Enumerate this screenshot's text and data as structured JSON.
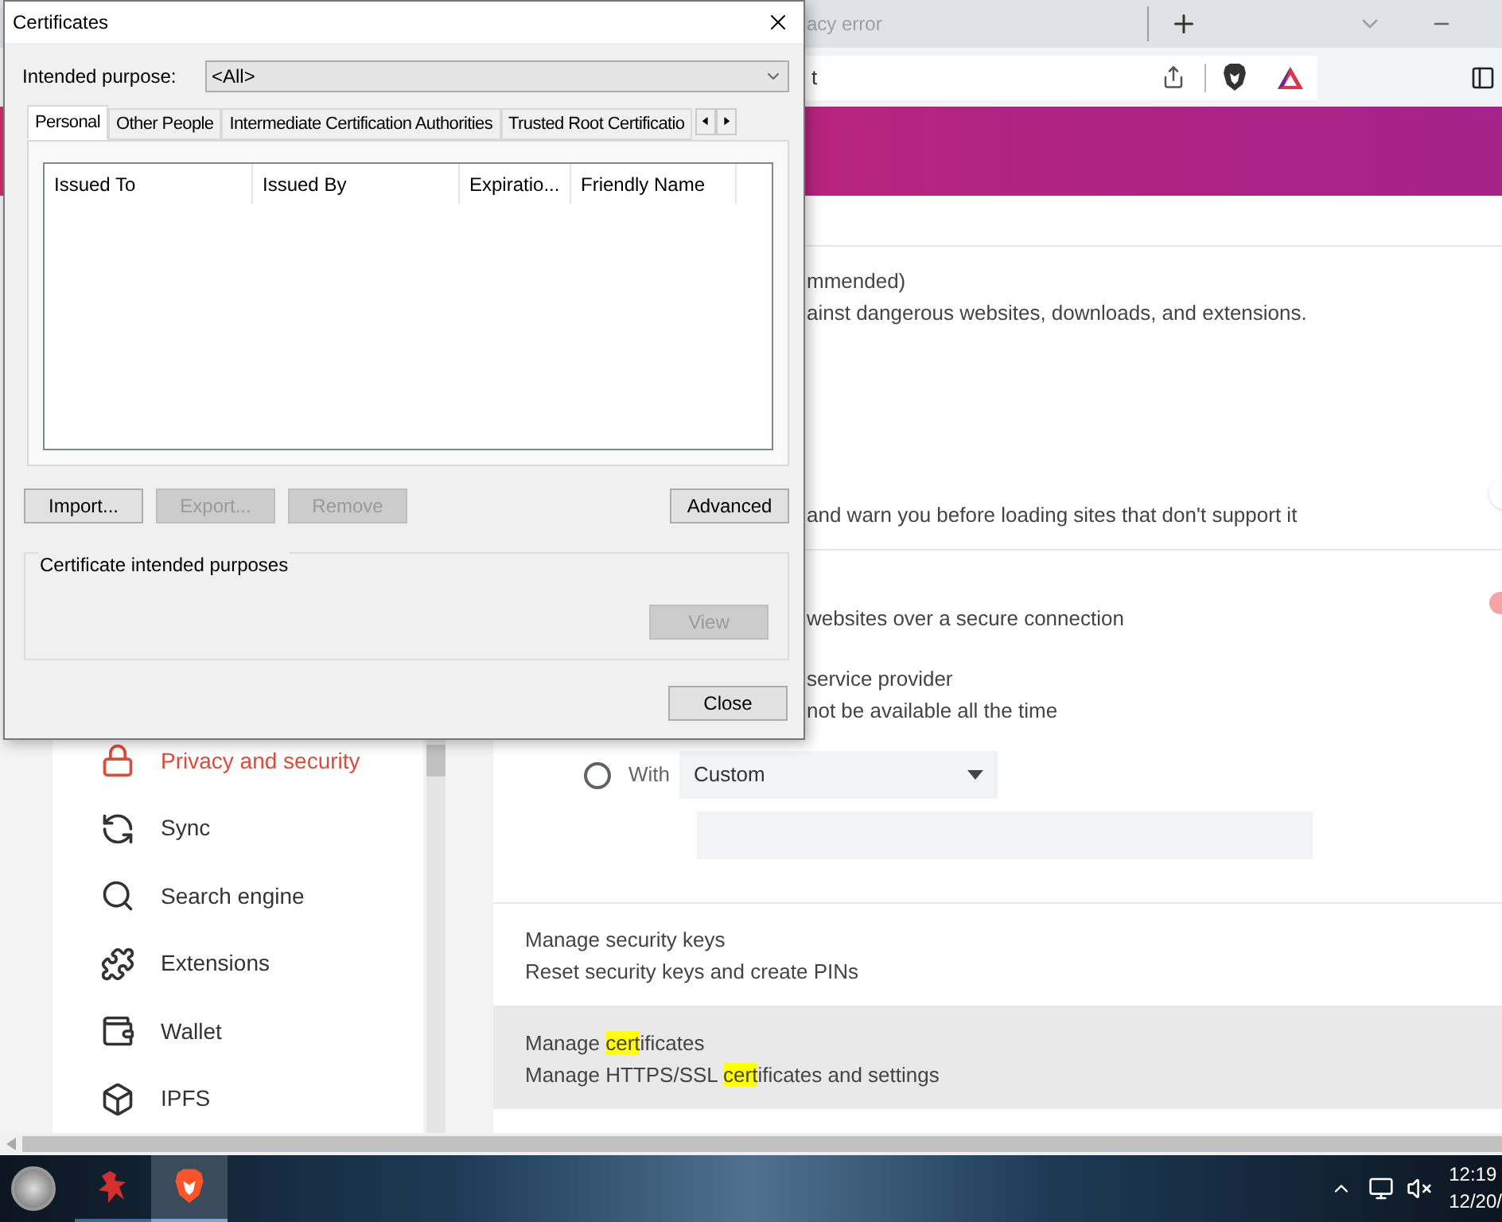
{
  "browser": {
    "tab": {
      "title": "acy error"
    },
    "address_field": {
      "value": "t"
    }
  },
  "sidebar": {
    "items": [
      {
        "label": "Privacy and security",
        "selected": true
      },
      {
        "label": "Sync",
        "selected": false
      },
      {
        "label": "Search engine",
        "selected": false
      },
      {
        "label": "Extensions",
        "selected": false
      },
      {
        "label": "Wallet",
        "selected": false
      },
      {
        "label": "IPFS",
        "selected": false
      }
    ]
  },
  "settings": {
    "safe_browsing": {
      "title": "mmended)",
      "description": "ainst dangerous websites, downloads, and extensions."
    },
    "always_https": {
      "description": "and warn you before loading sites that don't support it",
      "on": false
    },
    "secure_dns": {
      "description": "websites over a secure connection",
      "on": true,
      "option_title": "service provider",
      "option_description": "not be available all the time",
      "custom_option": {
        "selected": false,
        "label": "With",
        "provider": "Custom"
      }
    },
    "rows": [
      {
        "highlighted": false,
        "title": [
          {
            "text": "Manage security keys",
            "match": false
          }
        ],
        "description": [
          {
            "text": "Reset security keys and create PINs",
            "match": false
          }
        ]
      },
      {
        "highlighted": true,
        "title": [
          {
            "text": "Manage ",
            "match": false
          },
          {
            "text": "cert",
            "match": true
          },
          {
            "text": "ificates",
            "match": false
          }
        ],
        "description": [
          {
            "text": "Manage HTTPS/SSL ",
            "match": false
          },
          {
            "text": "cert",
            "match": true
          },
          {
            "text": "ificates and settings",
            "match": false
          }
        ]
      }
    ]
  },
  "dialog": {
    "title": "Certificates",
    "purpose_label": "Intended purpose:",
    "purpose_value": "<All>",
    "tabs": [
      {
        "label": "Personal",
        "selected": true
      },
      {
        "label": "Other People",
        "selected": false
      },
      {
        "label": "Intermediate Certification Authorities",
        "selected": false
      },
      {
        "label": "Trusted Root Certificatio",
        "selected": false
      }
    ],
    "columns": [
      "Issued To",
      "Issued By",
      "Expiratio...",
      "Friendly Name"
    ],
    "buttons": [
      {
        "label": "Import...",
        "disabled": false
      },
      {
        "label": "Export...",
        "disabled": true
      },
      {
        "label": "Remove",
        "disabled": true
      },
      {
        "label": "Advanced",
        "disabled": false
      }
    ],
    "purposes_group": {
      "label": "Certificate intended purposes",
      "button": {
        "label": "View",
        "disabled": true
      }
    },
    "close_button": "Close"
  },
  "taskbar": {
    "apps": [
      {
        "selected": false
      },
      {
        "selected": true
      }
    ],
    "clock": {
      "time": "12:19",
      "date": "12/20/"
    }
  }
}
